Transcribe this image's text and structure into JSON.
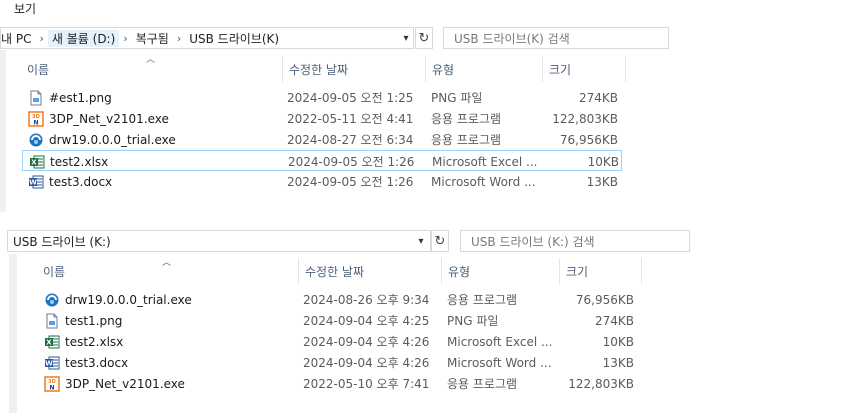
{
  "menu": {
    "label": "보기"
  },
  "top": {
    "breadcrumb": [
      "내 PC",
      "새 볼륨 (D:)",
      "복구됨",
      "USB 드라이브(K)"
    ],
    "search_placeholder": "USB 드라이브(K) 검색",
    "columns": {
      "name": "이름",
      "date": "수정한 날짜",
      "type": "유형",
      "size": "크기"
    },
    "files": [
      {
        "name": "#est1.png",
        "date": "2024-09-05 오전 1:25",
        "type": "PNG 파일",
        "size": "274KB",
        "icon": "png-file-icon"
      },
      {
        "name": "3DP_Net_v2101.exe",
        "date": "2022-05-11 오전 4:41",
        "type": "응용 프로그램",
        "size": "122,803KB",
        "icon": "3dp-net-app-icon"
      },
      {
        "name": "drw19.0.0.0_trial.exe",
        "date": "2024-08-27 오전 6:34",
        "type": "응용 프로그램",
        "size": "76,956KB",
        "icon": "drw-app-icon"
      },
      {
        "name": "test2.xlsx",
        "date": "2024-09-05 오전 1:26",
        "type": "Microsoft Excel ...",
        "size": "10KB",
        "icon": "excel-file-icon",
        "selected": true
      },
      {
        "name": "test3.docx",
        "date": "2024-09-05 오전 1:26",
        "type": "Microsoft Word ...",
        "size": "13KB",
        "icon": "word-file-icon"
      }
    ]
  },
  "bottom": {
    "address": "USB 드라이브 (K:)",
    "search_placeholder": "USB 드라이브 (K:) 검색",
    "columns": {
      "name": "이름",
      "date": "수정한 날짜",
      "type": "유형",
      "size": "크기"
    },
    "files": [
      {
        "name": "drw19.0.0.0_trial.exe",
        "date": "2024-08-26 오후 9:34",
        "type": "응용 프로그램",
        "size": "76,956KB",
        "icon": "drw-app-icon"
      },
      {
        "name": "test1.png",
        "date": "2024-09-04 오후 4:25",
        "type": "PNG 파일",
        "size": "274KB",
        "icon": "png-file-icon"
      },
      {
        "name": "test2.xlsx",
        "date": "2024-09-04 오후 4:26",
        "type": "Microsoft Excel ...",
        "size": "10KB",
        "icon": "excel-file-icon"
      },
      {
        "name": "test3.docx",
        "date": "2024-09-04 오후 4:26",
        "type": "Microsoft Word ...",
        "size": "13KB",
        "icon": "word-file-icon"
      },
      {
        "name": "3DP_Net_v2101.exe",
        "date": "2022-05-10 오후 7:41",
        "type": "응용 프로그램",
        "size": "122,803KB",
        "icon": "3dp-net-app-icon"
      }
    ]
  },
  "colors": {
    "header_text": "#4c607a",
    "selection_border": "#99d1ff",
    "excel": "#1d6f42",
    "word": "#2b579a",
    "exe_blue": "#1e73be",
    "orange": "#f07c1e"
  }
}
